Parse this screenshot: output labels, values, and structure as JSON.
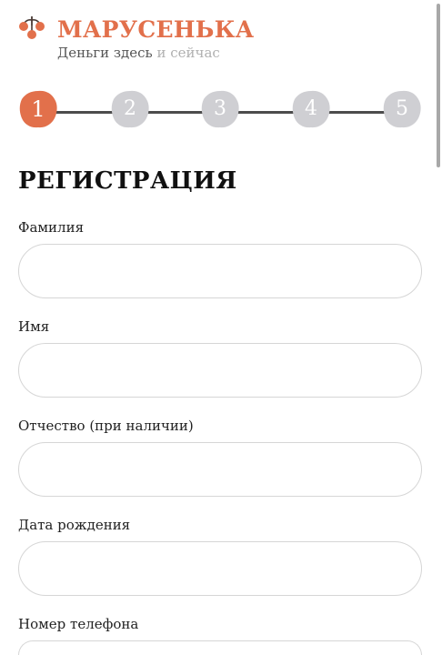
{
  "header": {
    "brand": "МАРУСЕНЬКА",
    "tagline_main": "Деньги здесь",
    "tagline_light": "и сейчас",
    "logo_icon": "berry-branch-icon"
  },
  "colors": {
    "accent": "#e2704b",
    "step_inactive": "#cfcfd3",
    "step_line": "#4c4c4c"
  },
  "stepper": {
    "current": 1,
    "steps": [
      "1",
      "2",
      "3",
      "4",
      "5"
    ]
  },
  "form": {
    "title": "РЕГИСТРАЦИЯ",
    "fields": [
      {
        "label": "Фамилия",
        "value": "",
        "placeholder": ""
      },
      {
        "label": "Имя",
        "value": "",
        "placeholder": ""
      },
      {
        "label": "Отчество (при наличии)",
        "value": "",
        "placeholder": ""
      },
      {
        "label": "Дата рождения",
        "value": "",
        "placeholder": ""
      },
      {
        "label": "Номер телефона",
        "value": "",
        "placeholder": ""
      }
    ]
  }
}
